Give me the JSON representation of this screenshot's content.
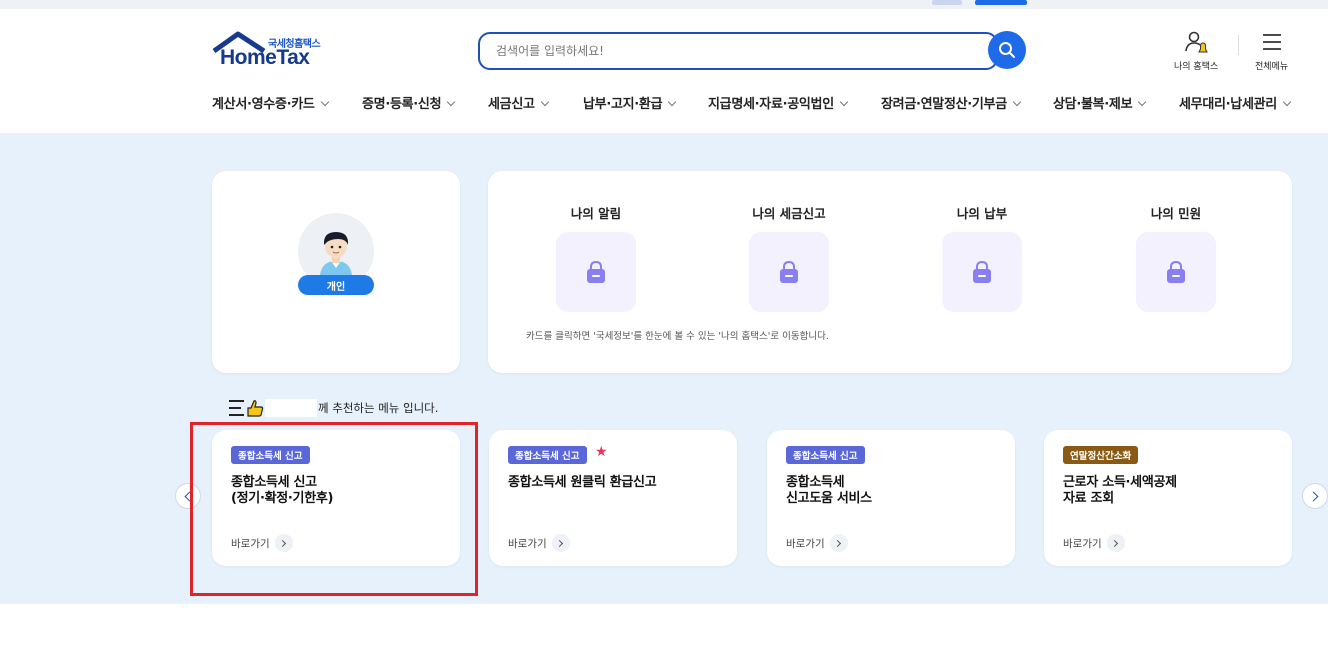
{
  "header": {
    "logo_sub": "국세청홈택스",
    "logo_main": "HomeTax",
    "search_placeholder": "검색어를 입력하세요!",
    "my_hometax_label": "나의 홈택스",
    "all_menu_label": "전체메뉴"
  },
  "nav": [
    "계산서·영수증·카드",
    "증명·등록·신청",
    "세금신고",
    "납부·고지·환급",
    "지급명세·자료·공익법인",
    "장려금·연말정산·기부금",
    "상담·불복·제보",
    "세무대리·납세관리"
  ],
  "profile": {
    "badge": "개인"
  },
  "quick": {
    "items": [
      "나의 알림",
      "나의 세금신고",
      "나의 납부",
      "나의 민원"
    ],
    "note": "카드를 클릭하면 '국세정보'를 한눈에 볼 수 있는 '나의 홈택스'로 이동합니다."
  },
  "recommend": {
    "title_suffix": "께 추천하는 메뉴 입니다.",
    "go_label": "바로가기",
    "cards": [
      {
        "tag": "종합소득세 신고",
        "title": "종합소득세 신고\n(정기·확정·기한후)",
        "tag_color": "#5a67d8",
        "starred": false
      },
      {
        "tag": "종합소득세 신고",
        "title": "종합소득세 원클릭 환급신고",
        "tag_color": "#5a67d8",
        "starred": true
      },
      {
        "tag": "종합소득세 신고",
        "title": "종합소득세\n신고도움 서비스",
        "tag_color": "#5a67d8",
        "starred": false
      },
      {
        "tag": "연말정산간소화",
        "title": "근로자 소득·세액공제\n자료 조회",
        "tag_color": "#8a5a14",
        "starred": false
      }
    ]
  },
  "colors": {
    "brand_blue": "#1f6ae8",
    "bg_light_blue": "#e6f1fb",
    "highlight_red": "#e1232a",
    "lock_purple": "#8a7ff0"
  }
}
